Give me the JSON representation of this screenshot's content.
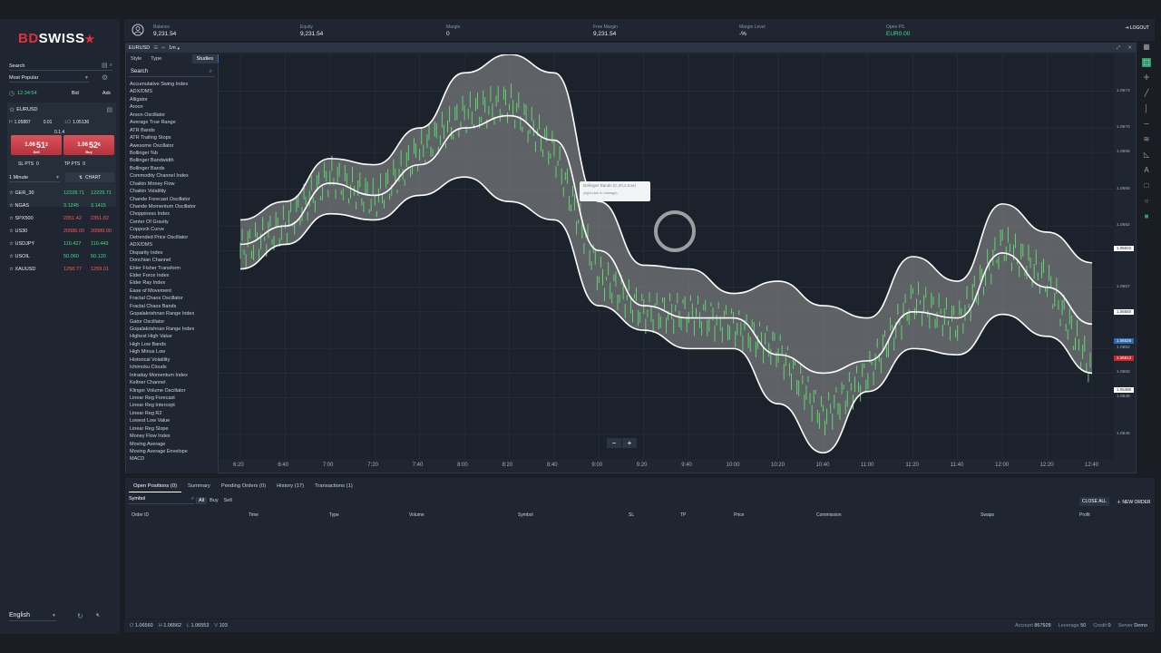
{
  "logo": {
    "part1": "BD",
    "part2": "SWISS",
    "star": "★"
  },
  "sidebar": {
    "search_label": "Search",
    "most_popular": "Most Popular",
    "time": "12:34:54",
    "bid_label": "Bid",
    "ask_label": "Ask",
    "instrument": "EURUSD",
    "high_label": "H",
    "high": "1.05887",
    "spread": "0.01",
    "low_label": "LO",
    "low": "1.05136",
    "spread2": "0.1.4",
    "sell_small": "1.06",
    "sell_big": "51",
    "sell_sup": "2",
    "sell_word": "Sell",
    "buy_small": "1.06",
    "buy_big": "52",
    "buy_sup": "6",
    "buy_word": "Buy",
    "sl_label": "SL PTS",
    "sl_val": "0",
    "tp_label": "TP PTS",
    "tp_val": "0",
    "timeframe": "1 Minute",
    "chart_button": "CHART",
    "watchlist": [
      {
        "sym": "GER_30",
        "bid": "12228.71",
        "ask": "12229.71",
        "color": "green"
      },
      {
        "sym": "NGAS",
        "bid": "3.1245",
        "ask": "3.1415",
        "color": "green"
      },
      {
        "sym": "SPX500",
        "bid": "2351.42",
        "ask": "2351.82",
        "color": "red"
      },
      {
        "sym": "US30",
        "bid": "20586.00",
        "ask": "20589.00",
        "color": "red"
      },
      {
        "sym": "USDJPY",
        "bid": "110.427",
        "ask": "110.443",
        "color": "green"
      },
      {
        "sym": "USOIL",
        "bid": "50.060",
        "ask": "50.120",
        "color": "green"
      },
      {
        "sym": "XAUUSD",
        "bid": "1258.77",
        "ask": "1259.01",
        "color": "red"
      }
    ],
    "language": "English"
  },
  "account": {
    "balance_label": "Balance",
    "balance": "9,231.54",
    "equity_label": "Equity",
    "equity": "9,231.54",
    "margin_label": "Margin",
    "margin": "0",
    "free_margin_label": "Free Margin",
    "free_margin": "9,231.54",
    "margin_level_label": "Margin Level",
    "margin_level": "-%",
    "open_pl_label": "Open P/L",
    "open_pl": "EUR0.00",
    "logout": "LOGOUT"
  },
  "chart_window": {
    "symbol": "EURUSD",
    "interval": "1m",
    "tabs": [
      "Style",
      "Type",
      "Studies"
    ],
    "search_label": "Search",
    "studies": [
      "Accumulative Swing Index",
      "ADX/DMS",
      "Alligator",
      "Aroon",
      "Aroon Oscillator",
      "Average True Range",
      "ATR Bands",
      "ATR Trailing Stops",
      "Awesome Oscillator",
      "Bollinger %b",
      "Bollinger Bandwidth",
      "Bollinger Bands",
      "Commodity Channel Index",
      "Chaikin Money Flow",
      "Chaikin Volatility",
      "Chande Forecast Oscillator",
      "Chande Momentum Oscillator",
      "Choppiness Index",
      "Center Of Gravity",
      "Coppock Curve",
      "Detrended Price Oscillator",
      "ADX/DMS",
      "Disparity Index",
      "Donchian Channel",
      "Ehler Fisher Transform",
      "Elder Force Index",
      "Elder Ray Index",
      "Ease of Movement",
      "Fractal Chaos Oscillator",
      "Fractal Chaos Bands",
      "Gopalakrishnan Range Index",
      "Gator Oscillator",
      "Gopalakrishnan Range Index",
      "Highest High Value",
      "High Low Bands",
      "High Minus Low",
      "Historical Volatility",
      "Ichimoku Clouds",
      "Intraday Momentum Index",
      "Keltner Channel",
      "Klinger Volume Oscillator",
      "Linear Reg Forecast",
      "Linear Reg Intercept",
      "Linear Reg R2",
      "Lowest Low Value",
      "Linear Reg Slope",
      "Money Flow Index",
      "Moving Average",
      "Moving Average Envelope",
      "MACD"
    ],
    "tooltip_title": "Bollinger Bands (C,20,2,true)",
    "tooltip_sub": "(right-click to manage)",
    "zoom_out": "−",
    "zoom_in": "+"
  },
  "chart_data": {
    "type": "line",
    "x_ticks": [
      "6:20",
      "6:40",
      "7:00",
      "7:20",
      "7:40",
      "8:00",
      "8:20",
      "8:40",
      "9:00",
      "9:20",
      "9:40",
      "10:00",
      "10:20",
      "10:40",
      "11:00",
      "11:20",
      "11:40",
      "12:00",
      "12:20",
      "12:40"
    ],
    "y_ticks": [
      "1.0673",
      "1.0670",
      "1.0668",
      "1.0665",
      "1.0662",
      "1.0660",
      "1.0657",
      "1.0655",
      "1.0652",
      "1.0650",
      "1.0648",
      "1.0645"
    ],
    "price_tags": [
      {
        "label": "1.06602",
        "value": 1.06602,
        "color": "#ffffff"
      },
      {
        "label": "1.06550",
        "value": 1.0655,
        "color": "#ffffff"
      },
      {
        "label": "1.06526",
        "value": 1.06526,
        "color": "#2a6fb5"
      },
      {
        "label": "1.06512",
        "value": 1.06512,
        "color": "#c62828"
      },
      {
        "label": "1.06486",
        "value": 1.06486,
        "color": "#ffffff"
      }
    ],
    "ylim": [
      1.0643,
      1.0676
    ],
    "series": [
      {
        "name": "Upper Band",
        "values": [
          1.06625,
          1.0664,
          1.06675,
          1.0667,
          1.067,
          1.06745,
          1.0676,
          1.06745,
          1.0664,
          1.06588,
          1.06585,
          1.06565,
          1.06575,
          1.06555,
          1.06545,
          1.06595,
          1.06575,
          1.06638,
          1.06615,
          1.0659
        ]
      },
      {
        "name": "Middle Band",
        "values": [
          1.06605,
          1.0662,
          1.06655,
          1.06645,
          1.0667,
          1.067,
          1.0671,
          1.0669,
          1.066,
          1.06555,
          1.06545,
          1.06545,
          1.06515,
          1.065,
          1.0651,
          1.0655,
          1.06545,
          1.06598,
          1.0657,
          1.0654
        ]
      },
      {
        "name": "Lower Band",
        "values": [
          1.06585,
          1.06605,
          1.0663,
          1.06625,
          1.06645,
          1.0666,
          1.0664,
          1.06625,
          1.06555,
          1.06535,
          1.0652,
          1.0652,
          1.06475,
          1.06435,
          1.06485,
          1.0652,
          1.06515,
          1.06548,
          1.0653,
          1.065
        ]
      },
      {
        "name": "Price",
        "values": [
          1.066,
          1.0662,
          1.0666,
          1.0664,
          1.0668,
          1.0671,
          1.0672,
          1.0668,
          1.0658,
          1.0655,
          1.0655,
          1.0654,
          1.0652,
          1.06465,
          1.065,
          1.0656,
          1.0654,
          1.06605,
          1.06575,
          1.065
        ]
      }
    ]
  },
  "bottom": {
    "tabs": [
      "Open Positions (0)",
      "Summary",
      "Pending Orders (0)",
      "History (17)",
      "Transactions (1)"
    ],
    "symbol_label": "Symbol",
    "filters": [
      "All",
      "Buy",
      "Sell"
    ],
    "close_all": "CLOSE ALL",
    "new_order": "NEW ORDER",
    "columns": [
      "Order ID",
      "Time",
      "Type",
      "Volume",
      "Symbol",
      "SL",
      "TP",
      "Price",
      "Commission",
      "Swaps",
      "Profit"
    ]
  },
  "status": {
    "o_label": "O",
    "o": "1.06560",
    "h_label": "H",
    "h": "1.06562",
    "l_label": "L",
    "l": "1.06553",
    "v_label": "V",
    "v": "103",
    "account_label": "Account",
    "account": "867928",
    "leverage_label": "Leverage",
    "leverage": "50",
    "credit_label": "Credit",
    "credit": "0",
    "server_label": "Server",
    "server": "Demo"
  }
}
